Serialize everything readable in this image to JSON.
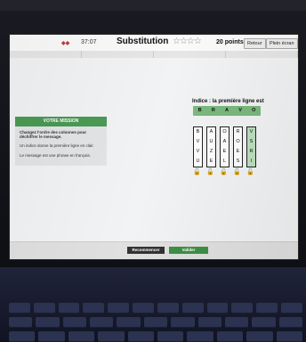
{
  "header": {
    "timer": "37:07",
    "title": "Substitution",
    "stars": "☆☆☆☆",
    "points": "20 points",
    "back_label": "Retour",
    "fullscreen_label": "Plein écran"
  },
  "mission": {
    "header": "VOTRE MISSION",
    "line1": "Changez l'ordre des colonnes pour déchiffrer le message.",
    "line2": "Un indice donne la première ligne en clair.",
    "line3": "Le message est une phrase en français."
  },
  "hint": {
    "label": "Indice : la première ligne est",
    "letters": [
      "B",
      "R",
      "A",
      "V",
      "O"
    ]
  },
  "columns": [
    [
      "B",
      "V",
      "V",
      "U"
    ],
    [
      "A",
      "U",
      "Z",
      "E"
    ],
    [
      "O",
      "A",
      "E",
      "L"
    ],
    [
      "R",
      "O",
      "E",
      "S"
    ],
    [
      "V",
      "S",
      "R",
      "I"
    ]
  ],
  "buttons": {
    "restart": "Recommencer",
    "validate": "Valider"
  }
}
